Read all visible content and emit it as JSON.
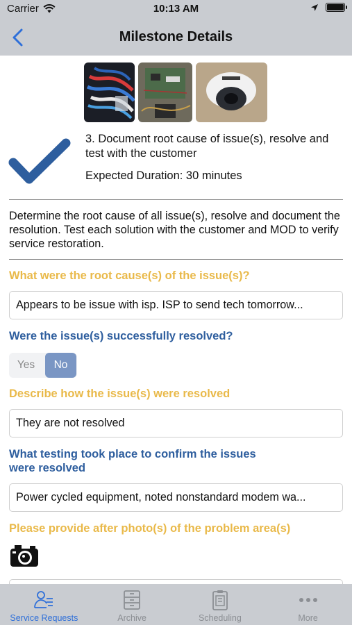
{
  "status_bar": {
    "carrier": "Carrier",
    "time": "10:13 AM"
  },
  "nav": {
    "title": "Milestone Details",
    "back_icon": "chevron-left-icon"
  },
  "milestone": {
    "title": "3. Document root cause of issue(s), resolve and test with the customer",
    "duration": "Expected Duration: 30 minutes",
    "completed": true,
    "photos": [
      "network-cables-photo",
      "circuit-board-photo",
      "security-camera-photo"
    ]
  },
  "description": "Determine the root cause of all issue(s), resolve and document the resolution. Test each solution with the customer and MOD to verify service restoration.",
  "questions": {
    "root_cause": {
      "label": "What were the root cause(s) of the issue(s)?",
      "value": "Appears to be issue with isp.  ISP to send tech tomorrow..."
    },
    "resolved": {
      "label": "Were the issue(s) successfully resolved?",
      "yes": "Yes",
      "no": "No",
      "selected": "No"
    },
    "how_resolved": {
      "label": "Describe how the issue(s) were resolved",
      "value": "They are not resolved"
    },
    "testing": {
      "label_line1": "What testing took place to confirm the issues",
      "label_line2": "were resolved",
      "value": "Power cycled equipment, noted nonstandard modem wa..."
    },
    "after_photos": {
      "label": "Please provide after photo(s) of the problem area(s)",
      "icon": "camera-icon"
    }
  },
  "tabs": [
    {
      "label": "Service Requests",
      "icon": "service-requests-icon",
      "active": true
    },
    {
      "label": "Archive",
      "icon": "archive-icon",
      "active": false
    },
    {
      "label": "Scheduling",
      "icon": "scheduling-icon",
      "active": false
    },
    {
      "label": "More",
      "icon": "more-icon",
      "active": false
    }
  ],
  "colors": {
    "accent_blue": "#2e5e9e",
    "gold": "#e9b949",
    "bar_gray": "#c9ccd1",
    "tab_active": "#2e6fd9",
    "toggle_active": "#7a96c4"
  }
}
